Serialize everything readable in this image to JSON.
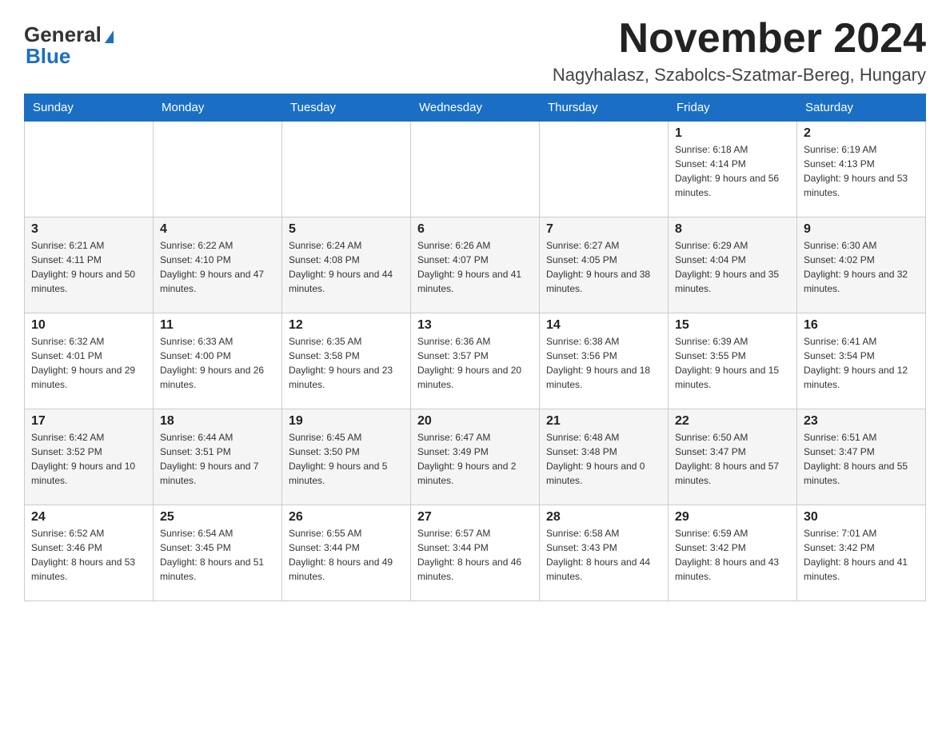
{
  "logo": {
    "name_part1": "General",
    "name_part2": "Blue"
  },
  "header": {
    "title": "November 2024",
    "subtitle": "Nagyhalasz, Szabolcs-Szatmar-Bereg, Hungary"
  },
  "days_of_week": [
    "Sunday",
    "Monday",
    "Tuesday",
    "Wednesday",
    "Thursday",
    "Friday",
    "Saturday"
  ],
  "weeks": [
    [
      {
        "day": "",
        "info": ""
      },
      {
        "day": "",
        "info": ""
      },
      {
        "day": "",
        "info": ""
      },
      {
        "day": "",
        "info": ""
      },
      {
        "day": "",
        "info": ""
      },
      {
        "day": "1",
        "info": "Sunrise: 6:18 AM\nSunset: 4:14 PM\nDaylight: 9 hours and 56 minutes."
      },
      {
        "day": "2",
        "info": "Sunrise: 6:19 AM\nSunset: 4:13 PM\nDaylight: 9 hours and 53 minutes."
      }
    ],
    [
      {
        "day": "3",
        "info": "Sunrise: 6:21 AM\nSunset: 4:11 PM\nDaylight: 9 hours and 50 minutes."
      },
      {
        "day": "4",
        "info": "Sunrise: 6:22 AM\nSunset: 4:10 PM\nDaylight: 9 hours and 47 minutes."
      },
      {
        "day": "5",
        "info": "Sunrise: 6:24 AM\nSunset: 4:08 PM\nDaylight: 9 hours and 44 minutes."
      },
      {
        "day": "6",
        "info": "Sunrise: 6:26 AM\nSunset: 4:07 PM\nDaylight: 9 hours and 41 minutes."
      },
      {
        "day": "7",
        "info": "Sunrise: 6:27 AM\nSunset: 4:05 PM\nDaylight: 9 hours and 38 minutes."
      },
      {
        "day": "8",
        "info": "Sunrise: 6:29 AM\nSunset: 4:04 PM\nDaylight: 9 hours and 35 minutes."
      },
      {
        "day": "9",
        "info": "Sunrise: 6:30 AM\nSunset: 4:02 PM\nDaylight: 9 hours and 32 minutes."
      }
    ],
    [
      {
        "day": "10",
        "info": "Sunrise: 6:32 AM\nSunset: 4:01 PM\nDaylight: 9 hours and 29 minutes."
      },
      {
        "day": "11",
        "info": "Sunrise: 6:33 AM\nSunset: 4:00 PM\nDaylight: 9 hours and 26 minutes."
      },
      {
        "day": "12",
        "info": "Sunrise: 6:35 AM\nSunset: 3:58 PM\nDaylight: 9 hours and 23 minutes."
      },
      {
        "day": "13",
        "info": "Sunrise: 6:36 AM\nSunset: 3:57 PM\nDaylight: 9 hours and 20 minutes."
      },
      {
        "day": "14",
        "info": "Sunrise: 6:38 AM\nSunset: 3:56 PM\nDaylight: 9 hours and 18 minutes."
      },
      {
        "day": "15",
        "info": "Sunrise: 6:39 AM\nSunset: 3:55 PM\nDaylight: 9 hours and 15 minutes."
      },
      {
        "day": "16",
        "info": "Sunrise: 6:41 AM\nSunset: 3:54 PM\nDaylight: 9 hours and 12 minutes."
      }
    ],
    [
      {
        "day": "17",
        "info": "Sunrise: 6:42 AM\nSunset: 3:52 PM\nDaylight: 9 hours and 10 minutes."
      },
      {
        "day": "18",
        "info": "Sunrise: 6:44 AM\nSunset: 3:51 PM\nDaylight: 9 hours and 7 minutes."
      },
      {
        "day": "19",
        "info": "Sunrise: 6:45 AM\nSunset: 3:50 PM\nDaylight: 9 hours and 5 minutes."
      },
      {
        "day": "20",
        "info": "Sunrise: 6:47 AM\nSunset: 3:49 PM\nDaylight: 9 hours and 2 minutes."
      },
      {
        "day": "21",
        "info": "Sunrise: 6:48 AM\nSunset: 3:48 PM\nDaylight: 9 hours and 0 minutes."
      },
      {
        "day": "22",
        "info": "Sunrise: 6:50 AM\nSunset: 3:47 PM\nDaylight: 8 hours and 57 minutes."
      },
      {
        "day": "23",
        "info": "Sunrise: 6:51 AM\nSunset: 3:47 PM\nDaylight: 8 hours and 55 minutes."
      }
    ],
    [
      {
        "day": "24",
        "info": "Sunrise: 6:52 AM\nSunset: 3:46 PM\nDaylight: 8 hours and 53 minutes."
      },
      {
        "day": "25",
        "info": "Sunrise: 6:54 AM\nSunset: 3:45 PM\nDaylight: 8 hours and 51 minutes."
      },
      {
        "day": "26",
        "info": "Sunrise: 6:55 AM\nSunset: 3:44 PM\nDaylight: 8 hours and 49 minutes."
      },
      {
        "day": "27",
        "info": "Sunrise: 6:57 AM\nSunset: 3:44 PM\nDaylight: 8 hours and 46 minutes."
      },
      {
        "day": "28",
        "info": "Sunrise: 6:58 AM\nSunset: 3:43 PM\nDaylight: 8 hours and 44 minutes."
      },
      {
        "day": "29",
        "info": "Sunrise: 6:59 AM\nSunset: 3:42 PM\nDaylight: 8 hours and 43 minutes."
      },
      {
        "day": "30",
        "info": "Sunrise: 7:01 AM\nSunset: 3:42 PM\nDaylight: 8 hours and 41 minutes."
      }
    ]
  ]
}
